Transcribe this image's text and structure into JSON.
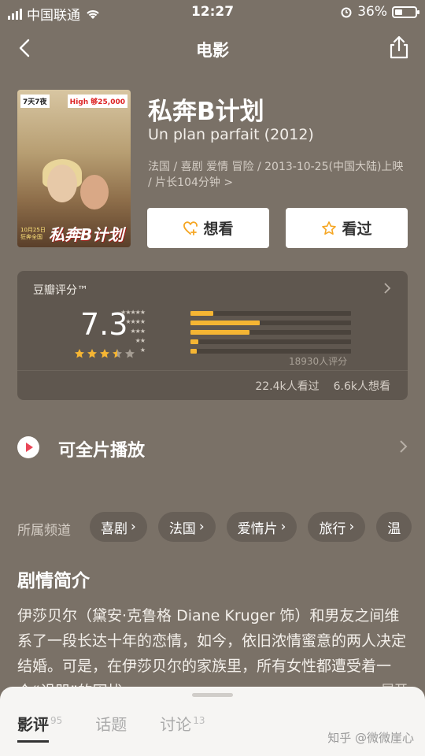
{
  "status_bar": {
    "carrier": "中国联通",
    "time": "12:27",
    "battery": "36%",
    "battery_level": 0.36
  },
  "nav": {
    "title": "电影"
  },
  "poster": {
    "badge_left": "7天7夜",
    "badge_right": "High 够25,000",
    "title": "私奔B计划",
    "date_text": "10月25日 狂奔全国"
  },
  "movie": {
    "title": "私奔B计划",
    "original_title": "Un plan parfait (2012)",
    "meta": "法国 / 喜剧 爱情 冒险 / 2013-10-25(中国大陆)上映 / 片长104分钟 >"
  },
  "actions": {
    "want_label": "想看",
    "seen_label": "看过"
  },
  "rating": {
    "label": "豆瓣评分™",
    "score": "7.3",
    "stars": 3.5,
    "distribution": [
      0.14,
      0.43,
      0.37,
      0.05,
      0.04
    ],
    "count_text": "18930人评分",
    "watched": "22.4k人看过",
    "wish": "6.6k人想看"
  },
  "play": {
    "label": "可全片播放"
  },
  "channels": {
    "label": "所属频道",
    "items": [
      "喜剧",
      "法国",
      "爱情片",
      "旅行",
      "温"
    ]
  },
  "synopsis": {
    "title": "剧情简介",
    "text": "伊莎贝尔（黛安·克鲁格 Diane Kruger 饰）和男友之间维系了一段长达十年的恋情，如今，依旧浓情蜜意的两人决定结婚。可是，在伊莎贝尔的家族里，所有女性都遭受着一个“诅咒”的困扰……",
    "expand_label": "展开"
  },
  "bottom_tabs": {
    "reviews_label": "影评",
    "reviews_count": "95",
    "topics_label": "话题",
    "discussions_label": "讨论",
    "discussions_count": "13"
  },
  "watermark": "知乎 @微微崖心",
  "colors": {
    "background": "#7a7167",
    "card": "#5f574f",
    "star": "#f5b533",
    "play": "#e94658"
  },
  "icons": {
    "back": "chevron-left-icon",
    "share": "share-icon",
    "want": "heart-plus-icon",
    "seen": "star-outline-icon",
    "play": "play-icon",
    "chevron": "chevron-right-icon"
  }
}
